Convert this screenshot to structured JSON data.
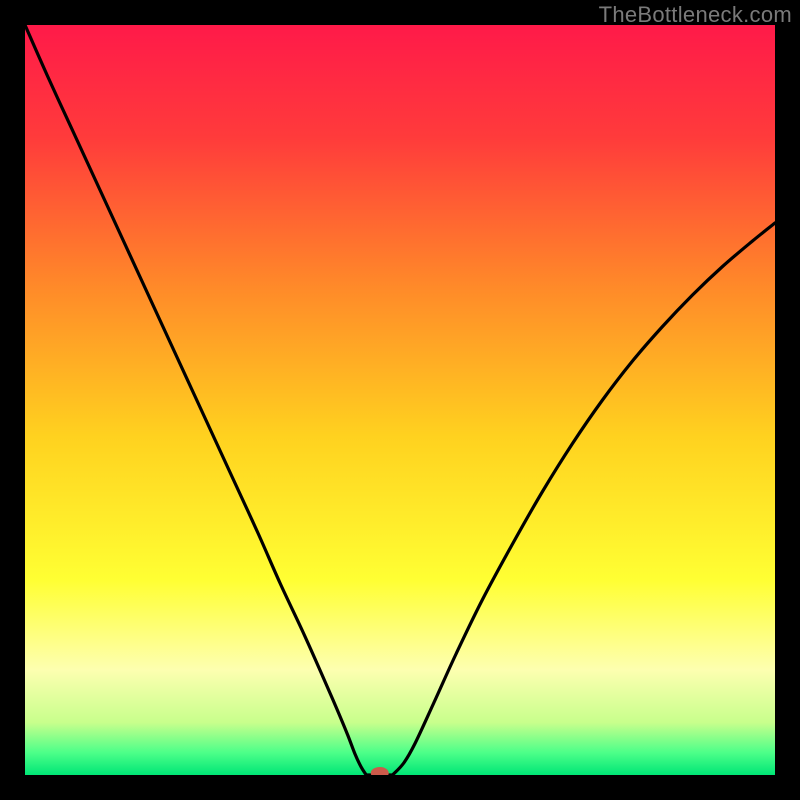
{
  "watermark": "TheBottleneck.com",
  "chart_data": {
    "type": "line",
    "title": "",
    "xlabel": "",
    "ylabel": "",
    "xlim": [
      0,
      100
    ],
    "ylim": [
      0,
      100
    ],
    "grid": false,
    "legend": false,
    "background_gradient_stops": [
      {
        "offset": 0.0,
        "color": "#ff1a49"
      },
      {
        "offset": 0.15,
        "color": "#ff3b3b"
      },
      {
        "offset": 0.35,
        "color": "#ff8a29"
      },
      {
        "offset": 0.55,
        "color": "#ffd21f"
      },
      {
        "offset": 0.74,
        "color": "#ffff33"
      },
      {
        "offset": 0.86,
        "color": "#fdffb0"
      },
      {
        "offset": 0.93,
        "color": "#c8ff8c"
      },
      {
        "offset": 0.97,
        "color": "#4dff89"
      },
      {
        "offset": 1.0,
        "color": "#00e676"
      }
    ],
    "curve": {
      "x": [
        0.0,
        3.0,
        6.5,
        10.0,
        13.5,
        17.0,
        20.5,
        24.0,
        27.5,
        31.0,
        34.0,
        37.0,
        39.5,
        41.5,
        43.0,
        44.0,
        44.8,
        45.5,
        47.0,
        48.5,
        49.3,
        50.5,
        52.0,
        54.5,
        57.5,
        61.0,
        65.0,
        69.0,
        73.0,
        77.0,
        81.0,
        85.0,
        89.0,
        93.0,
        97.0,
        100.0
      ],
      "y": [
        100.0,
        93.2,
        85.6,
        78.0,
        70.4,
        62.8,
        55.2,
        47.6,
        40.0,
        32.4,
        25.6,
        19.2,
        13.6,
        9.0,
        5.4,
        2.8,
        1.1,
        0.3,
        0.0,
        0.0,
        0.4,
        1.6,
        4.2,
        9.6,
        16.2,
        23.4,
        30.8,
        37.8,
        44.2,
        50.0,
        55.2,
        59.8,
        64.0,
        67.8,
        71.2,
        73.6
      ]
    },
    "valley_flat": {
      "x_start": 45.5,
      "x_end": 49.0,
      "y": 0.0
    },
    "marker": {
      "x": 47.3,
      "y": 0.0,
      "color": "#cc5a4a",
      "rx": 9,
      "ry": 6
    }
  }
}
